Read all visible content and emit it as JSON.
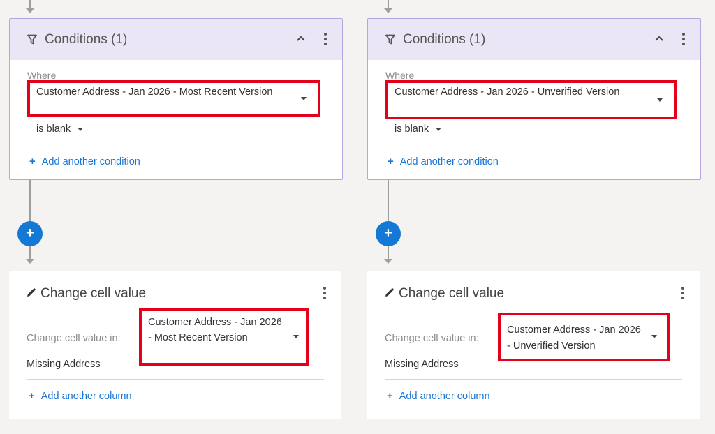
{
  "left": {
    "conditions_title": "Conditions (1)",
    "where_label": "Where",
    "where_column": "Customer Address - Jan 2026 - Most Recent Version",
    "operator": "is blank",
    "add_condition": "Add another condition",
    "plus_label": "+",
    "change_title": "Change cell value",
    "change_label": "Change cell value in:",
    "change_column": "Customer Address - Jan 2026 - Most Recent Version",
    "value": "Missing Address",
    "add_column": "Add another column"
  },
  "right": {
    "conditions_title": "Conditions (1)",
    "where_label": "Where",
    "where_column": "Customer Address - Jan 2026 - Unverified Version",
    "operator": "is blank",
    "add_condition": "Add another condition",
    "plus_label": "+",
    "change_title": "Change cell value",
    "change_label": "Change cell value in:",
    "change_column": "Customer Address - Jan 2026 - Unverified Version",
    "value": "Missing Address",
    "add_column": "Add another column"
  },
  "icons": [
    "filter-icon",
    "chevron-up-icon",
    "more-vert-icon",
    "caret-down-icon",
    "plus-icon",
    "pencil-icon"
  ],
  "colors": {
    "accent": "#1479d4",
    "link": "#1976d2",
    "highlight": "#e2001a",
    "card_header": "#ebe6f5",
    "card_border": "#b7a6de",
    "background": "#f4f3f2"
  }
}
